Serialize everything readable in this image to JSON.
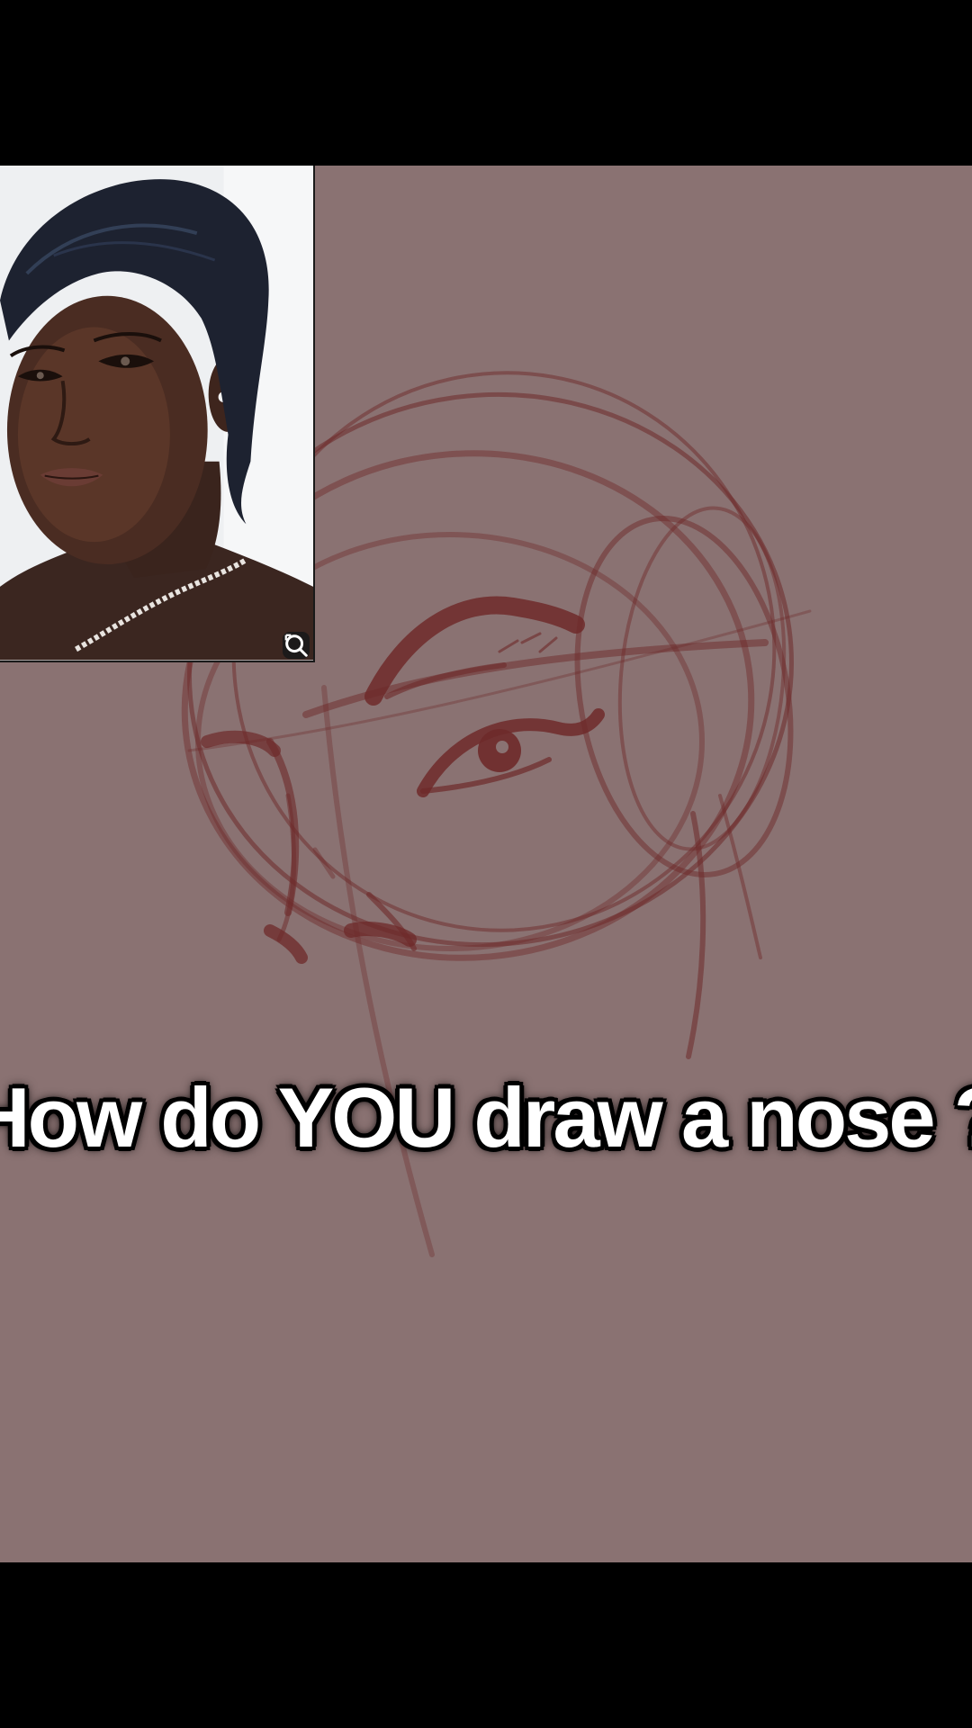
{
  "caption": {
    "text": "How do YOU draw a nose ?"
  },
  "reference_image": {
    "corner_button_icon": "lens-search-icon"
  },
  "colors": {
    "letterbox": "#000000",
    "canvas_background": "#8a7272",
    "sketch_stroke": "#6e2a2a",
    "caption_text": "#ffffff",
    "caption_outline": "#000000"
  }
}
